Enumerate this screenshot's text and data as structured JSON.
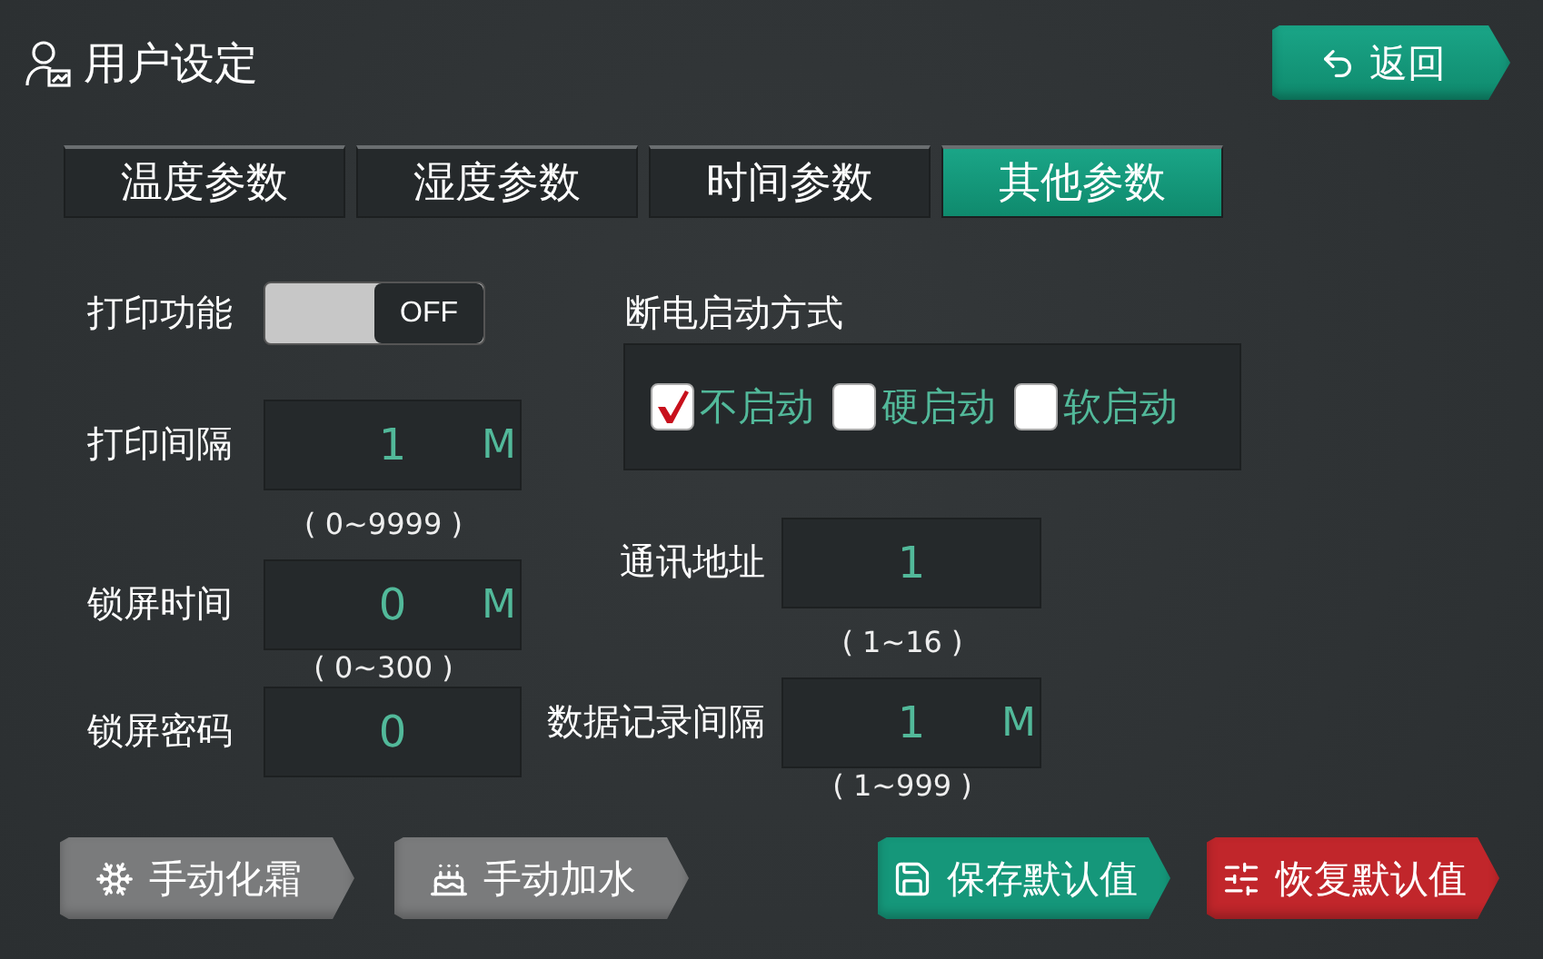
{
  "header": {
    "title": "用户设定",
    "back_button": "返回"
  },
  "tabs": [
    {
      "label": "温度参数",
      "selected": false
    },
    {
      "label": "湿度参数",
      "selected": false
    },
    {
      "label": "时间参数",
      "selected": false
    },
    {
      "label": "其他参数",
      "selected": true
    }
  ],
  "left_settings": [
    {
      "kind": "toggle",
      "label": "打印功能",
      "text": "OFF",
      "on": false
    },
    {
      "kind": "field",
      "label": "打印间隔",
      "value": "1",
      "unit": "M",
      "range": "( 0~9999 )"
    },
    {
      "kind": "field",
      "label": "锁屏时间",
      "value": "0",
      "unit": "M",
      "range": "( 0~300 )"
    },
    {
      "kind": "field",
      "label": "锁屏密码",
      "value": "0"
    }
  ],
  "power_on_mode": {
    "title": "断电启动方式",
    "options": [
      {
        "label": "不启动",
        "checked": true
      },
      {
        "label": "硬启动",
        "checked": false
      },
      {
        "label": "软启动",
        "checked": false
      }
    ]
  },
  "right_settings": [
    {
      "kind": "field",
      "label": "通讯地址",
      "value": "1",
      "range": "( 1~16 )"
    },
    {
      "kind": "field",
      "label": "数据记录间隔",
      "value": "1",
      "unit": "M",
      "range": "( 1~999 )"
    }
  ],
  "left_buttons": [
    {
      "kind": "defrost",
      "label": "手动化霜",
      "color": "#7a7b7c"
    },
    {
      "kind": "water",
      "label": "手动加水",
      "color": "#7a7b7c"
    }
  ],
  "right_buttons": [
    {
      "kind": "save",
      "label": "保存默认值",
      "color": "#15977a"
    },
    {
      "kind": "restore",
      "label": "恢复默认值",
      "color": "#c1262b"
    }
  ]
}
